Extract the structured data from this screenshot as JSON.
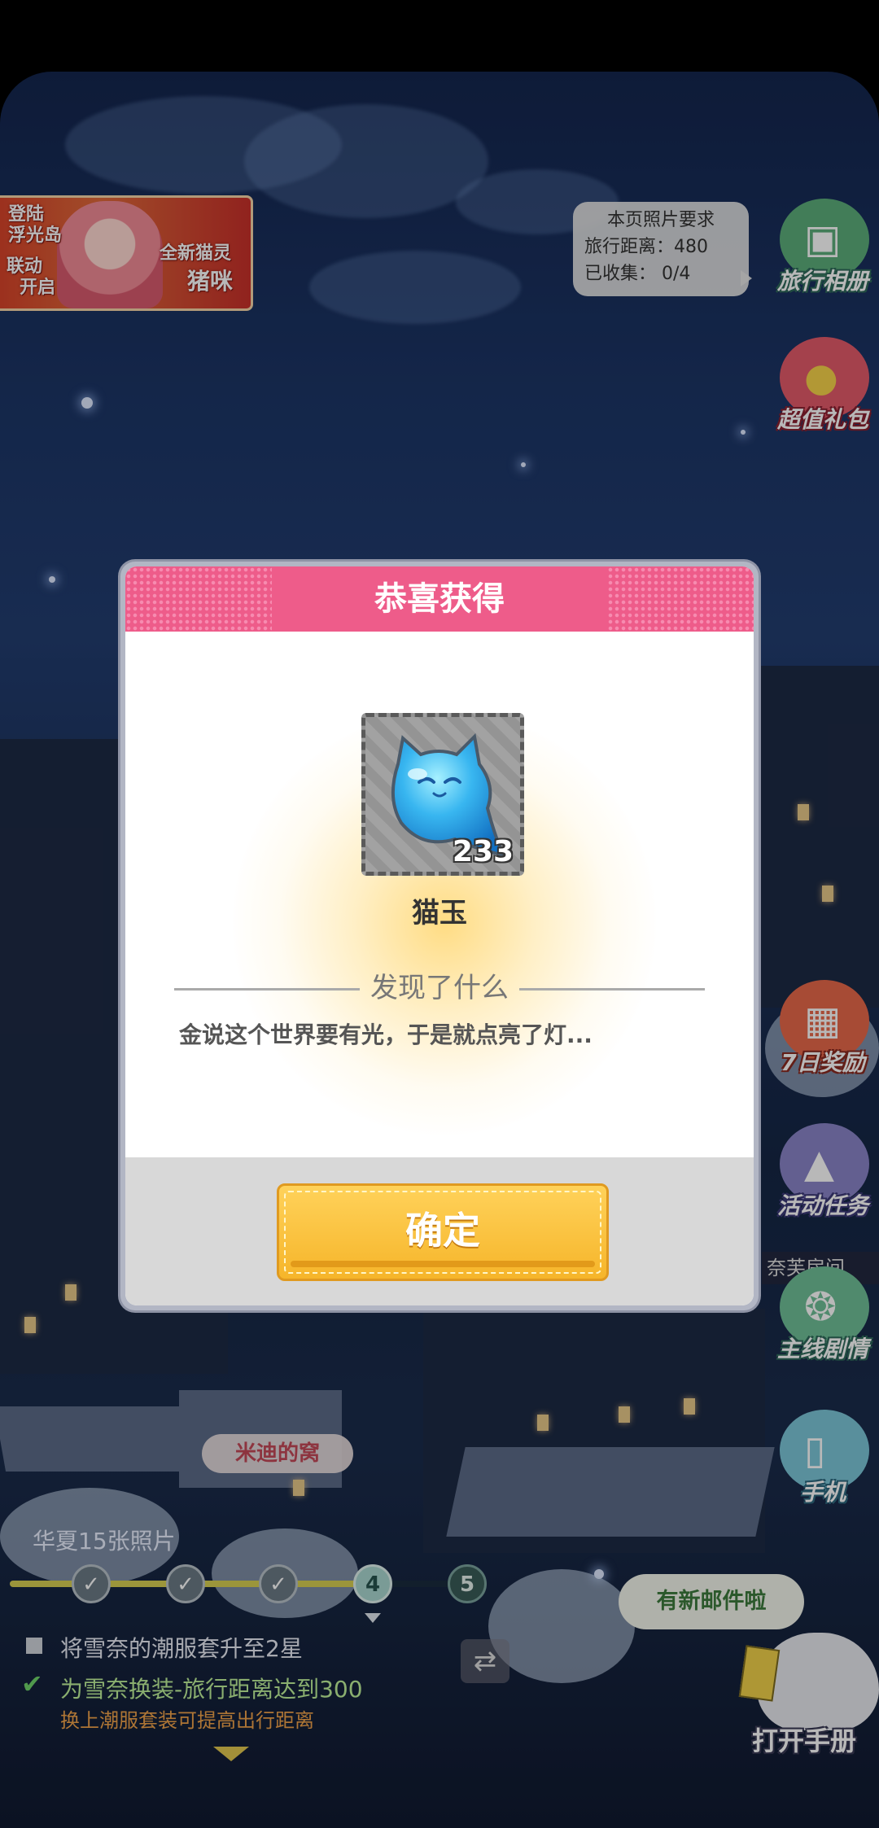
{
  "banner": {
    "line1": "登陆",
    "line2": "浮光岛",
    "line3": "联动",
    "line4": "开启",
    "line5": "全新猫灵",
    "line6": "猪咪"
  },
  "photo_requirement": {
    "title": "本页照片要求",
    "distance": "旅行距离：480",
    "collected": "已收集：   0/4"
  },
  "side_buttons": [
    {
      "label": "旅行相册",
      "icon": "camera-icon"
    },
    {
      "label": "超值礼包",
      "icon": "gift-bag-icon"
    },
    {
      "label": "7日奖励",
      "icon": "gift-box-icon"
    },
    {
      "label": "活动任务",
      "icon": "task-icon"
    },
    {
      "label": "主线剧情",
      "icon": "film-reel-icon"
    },
    {
      "label": "手机",
      "icon": "phone-icon"
    }
  ],
  "side_partial_label": "奈芙房间",
  "place_label": "米迪的窝",
  "photos_title": "华夏15张照片",
  "progress": {
    "nodes": [
      "",
      "",
      "",
      "4",
      "5"
    ],
    "completed": 3
  },
  "tasks": [
    {
      "text": "将雪奈的潮服套升至2星",
      "status": "todo"
    },
    {
      "text": "为雪奈换装-旅行距离达到300",
      "status": "done",
      "hint": "换上潮服套装可提高出行距离"
    }
  ],
  "mail": {
    "bubble": "有新邮件啦",
    "open_label": "打开手册"
  },
  "modal": {
    "title": "恭喜获得",
    "item_name": "猫玉",
    "item_count": "233",
    "section_title": "发现了什么",
    "description": "金说这个世界要有光，于是就点亮了灯...",
    "confirm": "确定"
  },
  "colors": {
    "modal_header": "#ee5c8a",
    "confirm_button": "#f6b52a",
    "item_color": "#38b6f0"
  }
}
